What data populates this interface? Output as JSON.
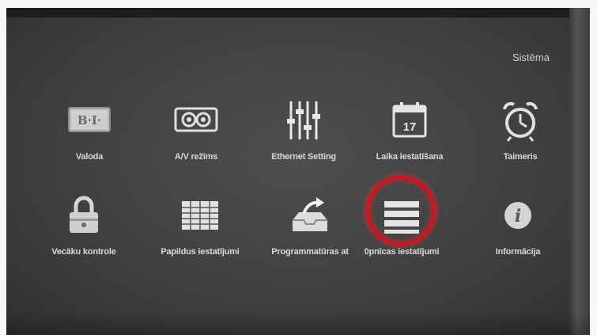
{
  "header": {
    "section_title": "Sistēma"
  },
  "menu": {
    "items": [
      {
        "label": "Valoda",
        "icon": "language-icon"
      },
      {
        "label": "A/V režīms",
        "icon": "av-mode-icon"
      },
      {
        "label": "Ethernet Setting",
        "icon": "equalizer-sliders-icon"
      },
      {
        "label": "Laika iestatīšana",
        "icon": "calendar-icon",
        "icon_text": "17"
      },
      {
        "label": "Taimeris",
        "icon": "alarm-clock-icon"
      },
      {
        "label": "Vecāku kontrole",
        "icon": "padlock-icon"
      },
      {
        "label": "Papildus iestatījumi",
        "icon": "grid-table-icon"
      },
      {
        "label": "Programmatūras at",
        "icon": "software-update-tray-icon"
      },
      {
        "label": "0pnīcas iestatījumi",
        "icon": "stacked-bars-icon",
        "selected": true
      },
      {
        "label": "Informācija",
        "icon": "info-icon",
        "icon_text": "i"
      }
    ]
  },
  "colors": {
    "background": "#434343",
    "label_text": "#d8d8d8",
    "focus_ring": "#c21a24"
  }
}
